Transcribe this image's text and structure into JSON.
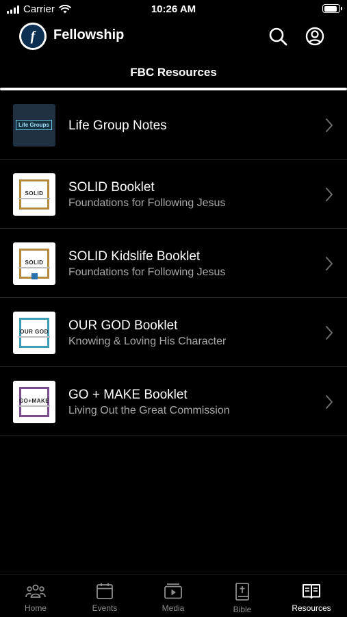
{
  "status_bar": {
    "carrier": "Carrier",
    "time": "10:26 AM",
    "battery_level": 0.9
  },
  "header": {
    "app_title": "Fellowship",
    "logo_letter": "f"
  },
  "segment": {
    "title": "FBC Resources"
  },
  "resources": [
    {
      "title": "Life Group Notes",
      "subtitle": "",
      "thumb_label": "Life Groups"
    },
    {
      "title": "SOLID Booklet",
      "subtitle": "Foundations for Following Jesus",
      "thumb_label": "SOLID",
      "frame_color": "#b58a3c"
    },
    {
      "title": "SOLID Kidslife Booklet",
      "subtitle": "Foundations for Following Jesus",
      "thumb_label": "SOLID",
      "frame_color": "#b58a3c"
    },
    {
      "title": "OUR GOD Booklet",
      "subtitle": "Knowing & Loving His Character",
      "thumb_label": "OUR GOD",
      "frame_color": "#3e9db6"
    },
    {
      "title": "GO + MAKE Booklet",
      "subtitle": "Living Out the Great Commission",
      "thumb_label": "GO+MAKE",
      "frame_color": "#7a4b8e"
    }
  ],
  "tabs": [
    {
      "label": "Home",
      "icon": "people-icon",
      "active": false
    },
    {
      "label": "Events",
      "icon": "calendar-icon",
      "active": false
    },
    {
      "label": "Media",
      "icon": "play-icon",
      "active": false
    },
    {
      "label": "Bible",
      "icon": "bible-icon",
      "active": false
    },
    {
      "label": "Resources",
      "icon": "book-icon",
      "active": true
    }
  ],
  "colors": {
    "background": "#000000",
    "text": "#ffffff",
    "subtitle": "#a9a9a9",
    "logo_bg": "#0d2f52"
  }
}
